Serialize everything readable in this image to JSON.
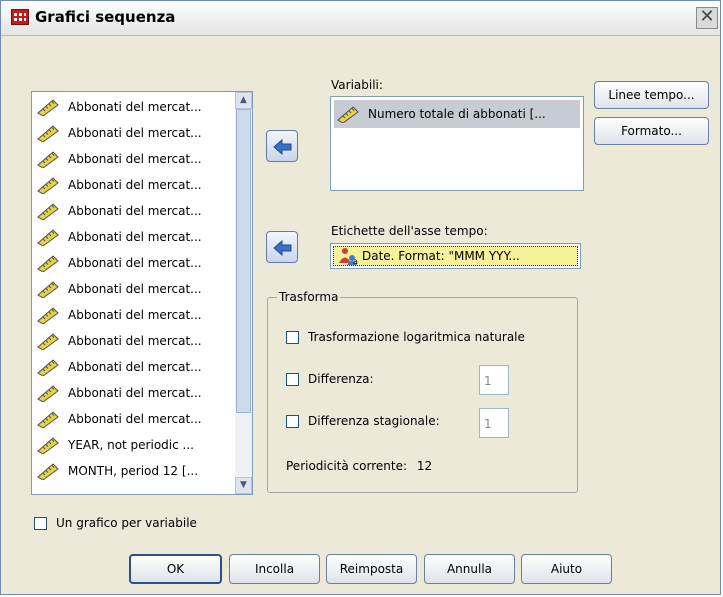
{
  "window": {
    "title": "Grafici sequenza",
    "close_glyph": "✕"
  },
  "source_list": {
    "items": [
      {
        "label": "Abbonati del mercat..."
      },
      {
        "label": "Abbonati del mercat..."
      },
      {
        "label": "Abbonati del mercat..."
      },
      {
        "label": "Abbonati del mercat..."
      },
      {
        "label": "Abbonati del mercat..."
      },
      {
        "label": "Abbonati del mercat..."
      },
      {
        "label": "Abbonati del mercat..."
      },
      {
        "label": "Abbonati del mercat..."
      },
      {
        "label": "Abbonati del mercat..."
      },
      {
        "label": "Abbonati del mercat..."
      },
      {
        "label": "Abbonati del mercat..."
      },
      {
        "label": "Abbonati del mercat..."
      },
      {
        "label": "Abbonati del mercat..."
      },
      {
        "label": "YEAR, not periodic ..."
      },
      {
        "label": "MONTH, period 12 [..."
      }
    ],
    "item_icon": "ruler-icon",
    "scroll_up": "▲",
    "scroll_down": "▼"
  },
  "variables": {
    "label": "Variabili:",
    "items": [
      "Numero totale di abbonati [..."
    ]
  },
  "time_axis": {
    "label": "Etichette dell'asse tempo:",
    "value": "Date.  Format:  \"MMM YYY..."
  },
  "transform": {
    "title": "Trasforma",
    "log_label": "Trasformazione logaritmica naturale",
    "log_checked": false,
    "diff_label": "Differenza:",
    "diff_checked": false,
    "diff_value": "1",
    "seasonal_label": "Differenza stagionale:",
    "seasonal_checked": false,
    "seasonal_value": "1",
    "periodicity_label": "Periodicità corrente:",
    "periodicity_value": "12"
  },
  "side_buttons": {
    "time_lines": "Linee tempo...",
    "format": "Formato..."
  },
  "one_chart": {
    "label": "Un grafico per variabile",
    "checked": false
  },
  "footer": {
    "ok": "OK",
    "paste": "Incolla",
    "reset": "Reimposta",
    "cancel": "Annulla",
    "help": "Aiuto"
  },
  "colors": {
    "selection": "#c7cbd3",
    "time_value_bg": "#f7f19a",
    "arrow": "#3a6fc8",
    "ruler": "#e6d24a"
  }
}
